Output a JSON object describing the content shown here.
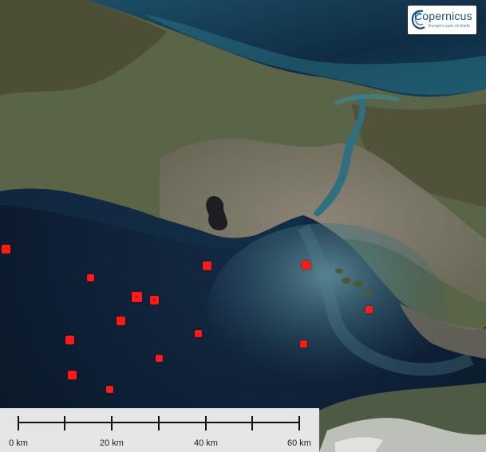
{
  "map": {
    "type": "satellite-imagery",
    "colors": {
      "sea": "#0b1a2c",
      "land": "#5c6548",
      "urban": "#8a8276",
      "sediment": "#3d6b7a",
      "marker": "#ff1a1a"
    }
  },
  "logo": {
    "brand": "Copernicus",
    "tagline": "Europe's eyes on Earth",
    "icon": "copernicus-logo-icon"
  },
  "markers": {
    "icon": "red-square-marker",
    "count": 15
  },
  "scale_bar": {
    "ticks": [
      {
        "label": "0 km"
      },
      {
        "label": ""
      },
      {
        "label": "20 km"
      },
      {
        "label": ""
      },
      {
        "label": "40 km"
      },
      {
        "label": ""
      },
      {
        "label": "60 km"
      }
    ]
  }
}
